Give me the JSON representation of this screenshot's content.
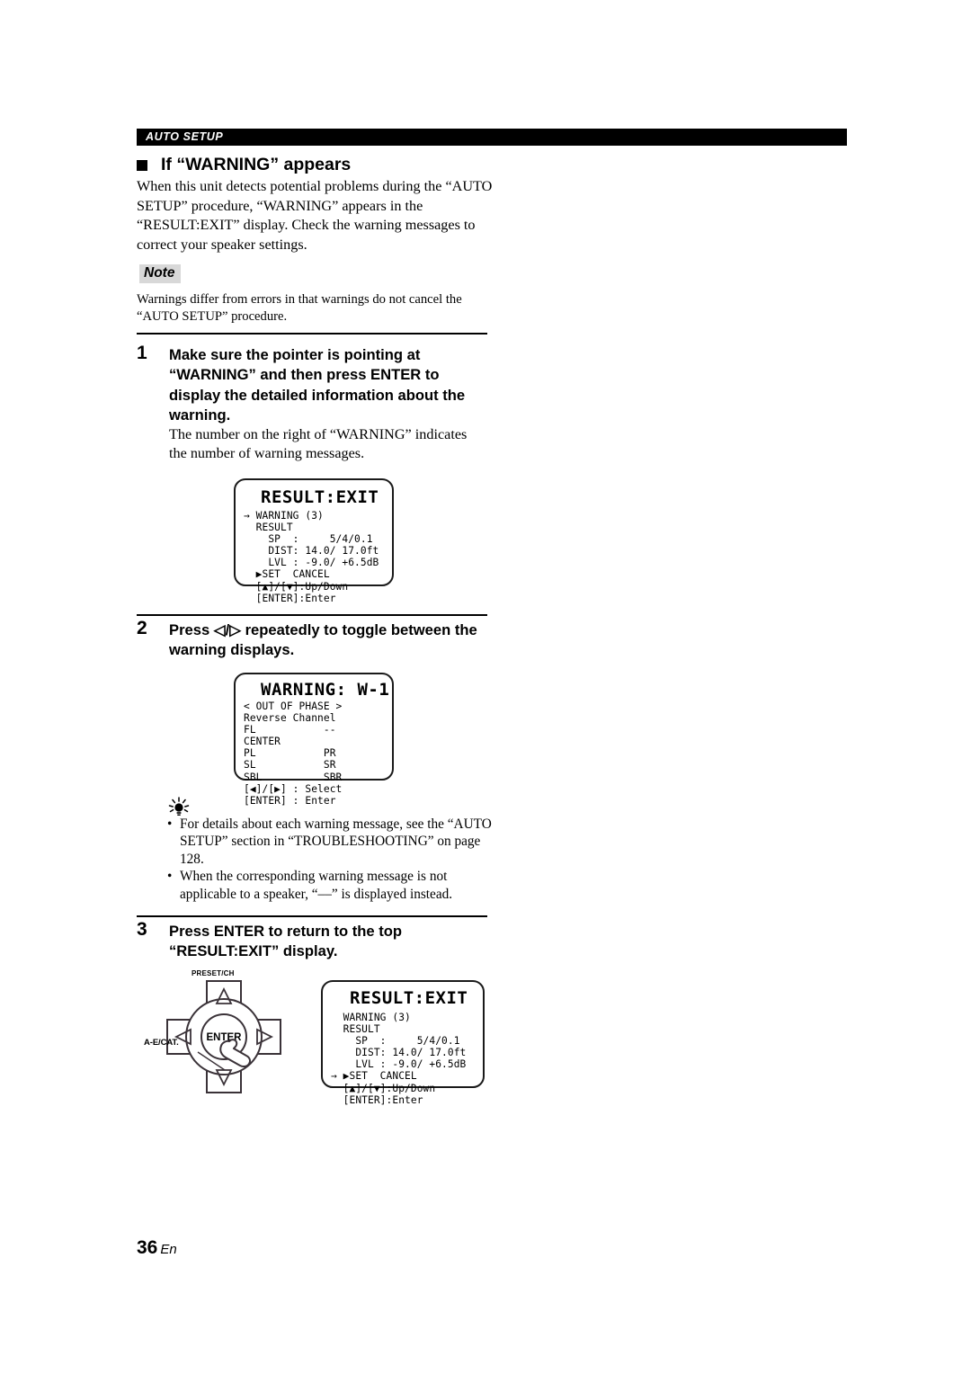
{
  "header": {
    "running_head": "AUTO SETUP"
  },
  "section": {
    "heading": "If “WARNING” appears",
    "intro": "When this unit detects potential problems during the “AUTO SETUP” procedure, “WARNING” appears in the “RESULT:EXIT” display. Check the warning messages to correct your speaker settings."
  },
  "note": {
    "label": "Note",
    "text": "Warnings differ from errors in that warnings do not cancel the “AUTO SETUP” procedure."
  },
  "steps": [
    {
      "number": "1",
      "title": "Make sure the pointer is pointing at “WARNING” and then press ENTER to display the detailed information about the warning.",
      "body": "The number on the right of “WARNING” indicates the number of warning messages."
    },
    {
      "number": "2",
      "title": "Press ◁/▷ repeatedly to toggle between the warning displays.",
      "body": ""
    },
    {
      "number": "3",
      "title": "Press ENTER to return to the top “RESULT:EXIT” display.",
      "body": ""
    }
  ],
  "displays": [
    {
      "id": "result-exit-top",
      "title": "RESULT:EXIT",
      "lines": [
        "→ WARNING (3)",
        "  RESULT",
        "    SP  :     5/4/0.1",
        "    DIST: 14.0/ 17.0ft",
        "    LVL : -9.0/ +6.5dB",
        "  ▶SET  CANCEL",
        "  [▲]/[▼]:Up/Down",
        "  [ENTER]:Enter"
      ]
    },
    {
      "id": "warning-w1",
      "title": "WARNING: W-1",
      "lines": [
        "< OUT OF PHASE >",
        "Reverse Channel",
        "FL           --",
        "CENTER",
        "PL           PR",
        "SL           SR",
        "SBL          SBR",
        "[◀]/[▶] : Select",
        "[ENTER] : Enter"
      ]
    },
    {
      "id": "result-exit-return",
      "title": "RESULT:EXIT",
      "lines": [
        "  WARNING (3)",
        "  RESULT",
        "    SP  :     5/4/0.1",
        "    DIST: 14.0/ 17.0ft",
        "    LVL : -9.0/ +6.5dB",
        "→ ▶SET  CANCEL",
        "  [▲]/[▼]:Up/Down",
        "  [ENTER]:Enter"
      ]
    }
  ],
  "tips": {
    "items": [
      "For details about each warning message, see the “AUTO SETUP” section in “TROUBLESHOOTING” on page 128.",
      "When the corresponding warning message is not applicable to a speaker, “––” is displayed instead."
    ]
  },
  "remote": {
    "preset_label": "PRESET/CH",
    "ae_cat_label": "A-E/CAT.",
    "enter_label": "ENTER"
  },
  "footer": {
    "page_number": "36",
    "language": "En"
  },
  "colors": {
    "header_bar": "#000000",
    "note_tag_bg": "#d8d8d8",
    "text": "#000000",
    "page_bg": "#ffffff"
  }
}
